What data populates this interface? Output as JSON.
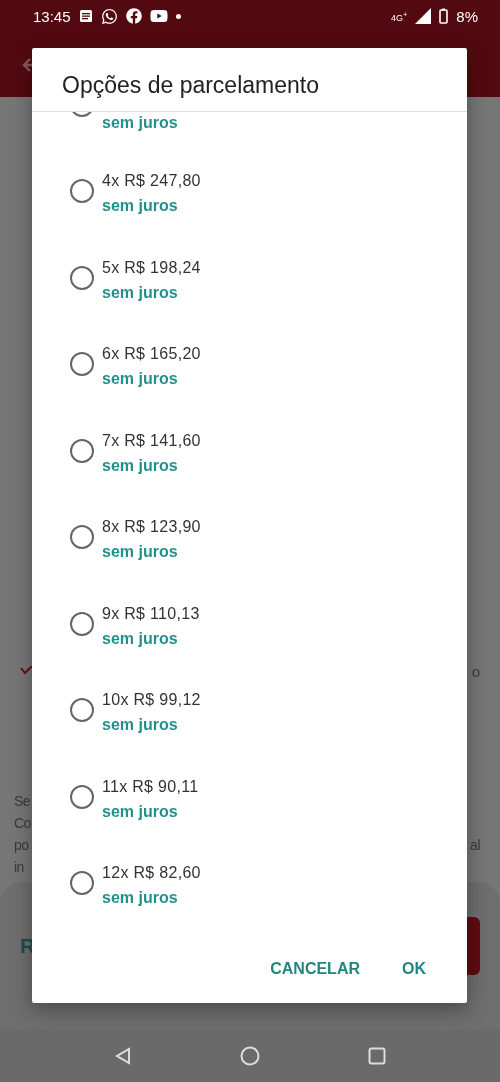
{
  "status_bar": {
    "time": "13:45",
    "network": "4G$^{+}$",
    "battery": "8%"
  },
  "background": {
    "row_right": "o",
    "paragraph_lines": [
      "Se",
      "Co",
      "po",
      "in"
    ],
    "paragraph_right": "al",
    "footer_text": "R"
  },
  "dialog": {
    "title": "Opções de parcelamento",
    "options": [
      {
        "kind": "partial",
        "note": "sem juros",
        "selected": false
      },
      {
        "kind": "full",
        "price": "4x R$ 247,80",
        "note": "sem juros",
        "selected": false
      },
      {
        "kind": "full",
        "price": "5x R$ 198,24",
        "note": "sem juros",
        "selected": false
      },
      {
        "kind": "full",
        "price": "6x R$ 165,20",
        "note": "sem juros",
        "selected": false
      },
      {
        "kind": "full",
        "price": "7x R$ 141,60",
        "note": "sem juros",
        "selected": false
      },
      {
        "kind": "full",
        "price": "8x R$ 123,90",
        "note": "sem juros",
        "selected": false
      },
      {
        "kind": "full",
        "price": "9x R$ 110,13",
        "note": "sem juros",
        "selected": false
      },
      {
        "kind": "full",
        "price": "10x R$ 99,12",
        "note": "sem juros",
        "selected": false
      },
      {
        "kind": "full",
        "price": "11x R$ 90,11",
        "note": "sem juros",
        "selected": false
      },
      {
        "kind": "full",
        "price": "12x R$ 82,60",
        "note": "sem juros",
        "selected": false
      }
    ],
    "buttons": [
      "CANCELAR",
      "OK"
    ]
  }
}
